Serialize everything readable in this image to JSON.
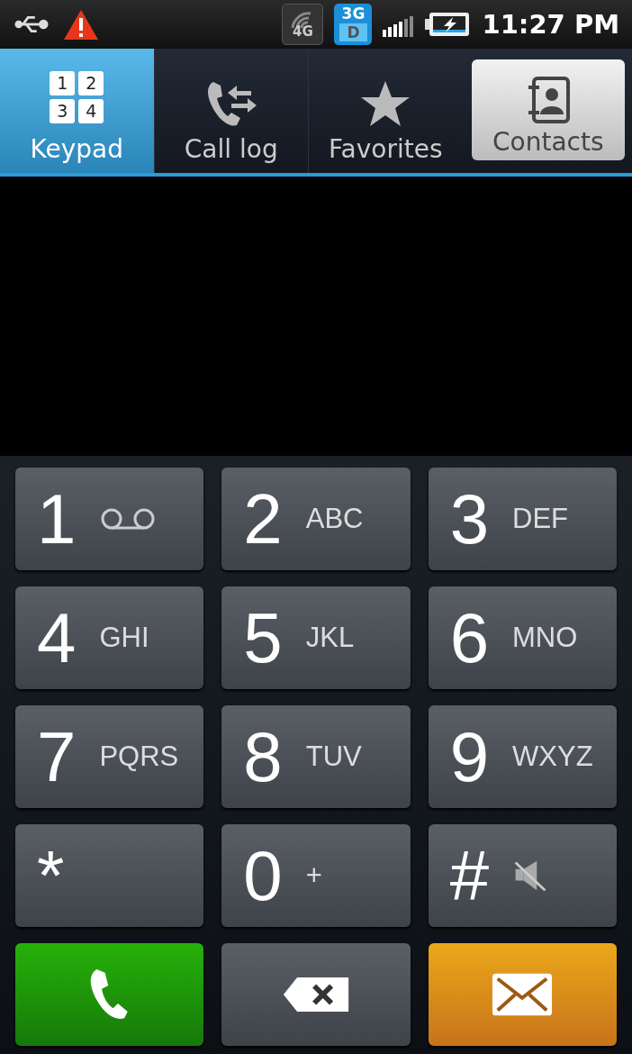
{
  "status_bar": {
    "time": "11:27 PM",
    "badges": [
      {
        "kind": "wifi",
        "label": "4G"
      },
      {
        "kind": "data",
        "label": "3G",
        "sub": "D"
      }
    ]
  },
  "tabs": [
    {
      "kind": "keypad",
      "label": "Keypad",
      "selected": true,
      "pressed": false,
      "digits": [
        "1",
        "2",
        "3",
        "4"
      ]
    },
    {
      "kind": "calllog",
      "label": "Call log",
      "selected": false,
      "pressed": false
    },
    {
      "kind": "favorites",
      "label": "Favorites",
      "selected": false,
      "pressed": false
    },
    {
      "kind": "contacts",
      "label": "Contacts",
      "selected": false,
      "pressed": true
    }
  ],
  "keys": [
    {
      "kind": "voicemail",
      "digit": "1"
    },
    {
      "kind": "letters",
      "digit": "2",
      "letters": "ABC"
    },
    {
      "kind": "letters",
      "digit": "3",
      "letters": "DEF"
    },
    {
      "kind": "letters",
      "digit": "4",
      "letters": "GHI"
    },
    {
      "kind": "letters",
      "digit": "5",
      "letters": "JKL"
    },
    {
      "kind": "letters",
      "digit": "6",
      "letters": "MNO"
    },
    {
      "kind": "letters",
      "digit": "7",
      "letters": "PQRS"
    },
    {
      "kind": "letters",
      "digit": "8",
      "letters": "TUV"
    },
    {
      "kind": "letters",
      "digit": "9",
      "letters": "WXYZ"
    },
    {
      "kind": "plain",
      "digit": "*"
    },
    {
      "kind": "letters",
      "digit": "0",
      "letters": "+"
    },
    {
      "kind": "mute",
      "digit": "#"
    }
  ],
  "actions": [
    {
      "kind": "call"
    },
    {
      "kind": "delete"
    },
    {
      "kind": "message"
    }
  ]
}
